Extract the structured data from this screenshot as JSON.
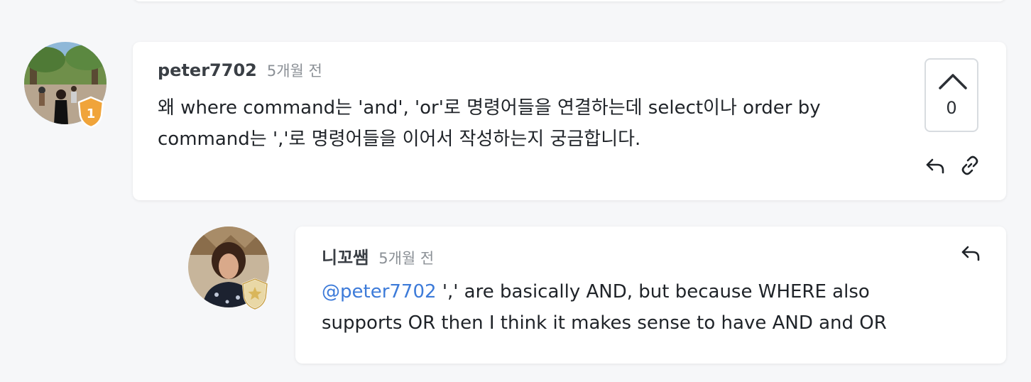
{
  "comments": [
    {
      "username": "peter7702",
      "time": "5개월 전",
      "rank_badge": "1",
      "text_line1": "왜 where command는 'and', 'or'로 명령어들을 연결하는데 select이나 order by",
      "text_line2": "command는 ','로 명령어들을 이어서 작성하는지 궁금합니다.",
      "vote_count": "0"
    }
  ],
  "reply": {
    "username": "니꼬쌤",
    "time": "5개월 전",
    "mention": "@peter7702",
    "text_line1": " ',' are basically AND, but because WHERE also",
    "text_line2": "supports OR then I think it makes sense to have AND and OR"
  },
  "icons": {
    "vote_up": "chevron-up-icon",
    "reply": "reply-icon",
    "link": "link-icon",
    "rank_badge": "shield-badge-icon",
    "staff_badge": "star-shield-icon"
  },
  "colors": {
    "background": "#f6f7f9",
    "card": "#ffffff",
    "mention": "#3d7bd9",
    "badge_orange": "#f0a43a",
    "badge_gold": "#d9b65a"
  }
}
